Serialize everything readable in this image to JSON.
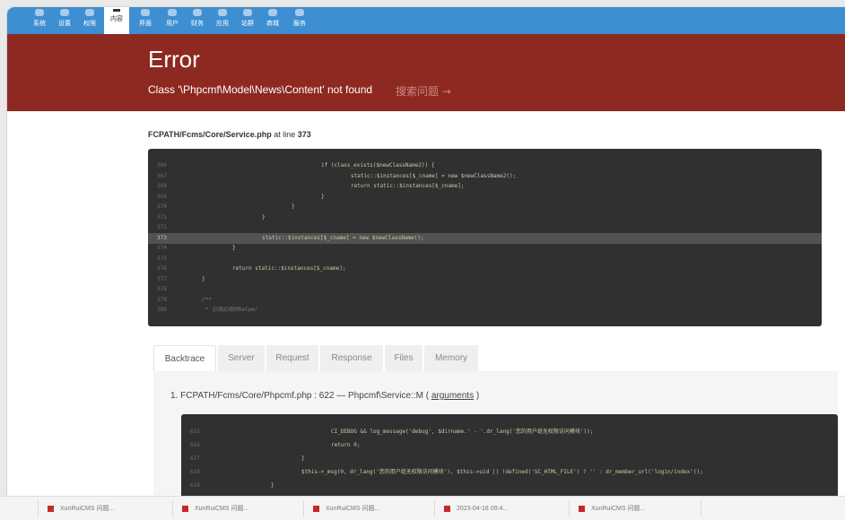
{
  "top_nav": {
    "items": [
      {
        "label": "系统"
      },
      {
        "label": "设置"
      },
      {
        "label": "权限"
      },
      {
        "label": "内容",
        "active": true
      },
      {
        "label": "界面"
      },
      {
        "label": "用户"
      },
      {
        "label": "财务"
      },
      {
        "label": "应用"
      },
      {
        "label": "站群"
      },
      {
        "label": "商城"
      },
      {
        "label": "服务"
      }
    ]
  },
  "error": {
    "title": "Error",
    "message": "Class '\\Phpcmf\\Model\\News\\Content' not found",
    "search_link": "搜索问题 →"
  },
  "location": {
    "file": "FCPATH/Fcms/Core/Service.php",
    "at_line_text": " at line ",
    "line": "373"
  },
  "source": {
    "highlight_line": "373",
    "lines": [
      {
        "n": "366",
        "code": "if (class_exists($newClassName2)) {"
      },
      {
        "n": "367",
        "code": "static::$instances[$_cname] = new $newClassName2();"
      },
      {
        "n": "368",
        "code": "return static::$instances[$_cname];"
      },
      {
        "n": "369",
        "code": "}"
      },
      {
        "n": "370",
        "code": "}"
      },
      {
        "n": "371",
        "code": "}"
      },
      {
        "n": "372",
        "code": ""
      },
      {
        "n": "373",
        "code": "static::$instances[$_cname] = new $newClassName();"
      },
      {
        "n": "374",
        "code": "}"
      },
      {
        "n": "375",
        "code": ""
      },
      {
        "n": "376",
        "code": "return static::$instances[$_cname];"
      },
      {
        "n": "377",
        "code": "}"
      },
      {
        "n": "378",
        "code": ""
      },
      {
        "n": "379",
        "code": "/**"
      },
      {
        "n": "380",
        "code": " * 引用应用的helper"
      }
    ]
  },
  "tabs": [
    {
      "label": "Backtrace",
      "active": true
    },
    {
      "label": "Server"
    },
    {
      "label": "Request"
    },
    {
      "label": "Response"
    },
    {
      "label": "Files"
    },
    {
      "label": "Memory"
    }
  ],
  "backtrace": {
    "entry_prefix": "1. FCPATH/Fcms/Core/Phpcmf.php : 622  —  Phpcmf\\Service::M ( ",
    "arguments_link": "arguments",
    "entry_suffix": " )",
    "lines": [
      {
        "n": "615",
        "code": "CI_DEBUG && log_message('debug', $dirname.' - '.dr_lang('您的用户组无权限访问模块'));"
      },
      {
        "n": "616",
        "code": "return 0;"
      },
      {
        "n": "617",
        "code": "}"
      },
      {
        "n": "618",
        "code": "$this->_msg(0, dr_lang('您的用户组无权限访问模块'), $this->uid || !defined('SC_HTML_FILE') ? '' : dr_member_url('login/index'));"
      },
      {
        "n": "619",
        "code": "}"
      }
    ]
  },
  "taskbar": {
    "tasks": [
      {
        "label": "XunRuiCMS 问题..."
      },
      {
        "label": "XunRuiCMS 问题..."
      },
      {
        "label": "XunRuiCMS 问题..."
      },
      {
        "label": "2023-04-18 09:4..."
      },
      {
        "label": "XunRuiCMS 问题..."
      }
    ]
  },
  "colors": {
    "nav": "#3e8fd1",
    "error_banner": "#8d2920",
    "code_bg": "#303030",
    "code_highlight": "#525252"
  }
}
